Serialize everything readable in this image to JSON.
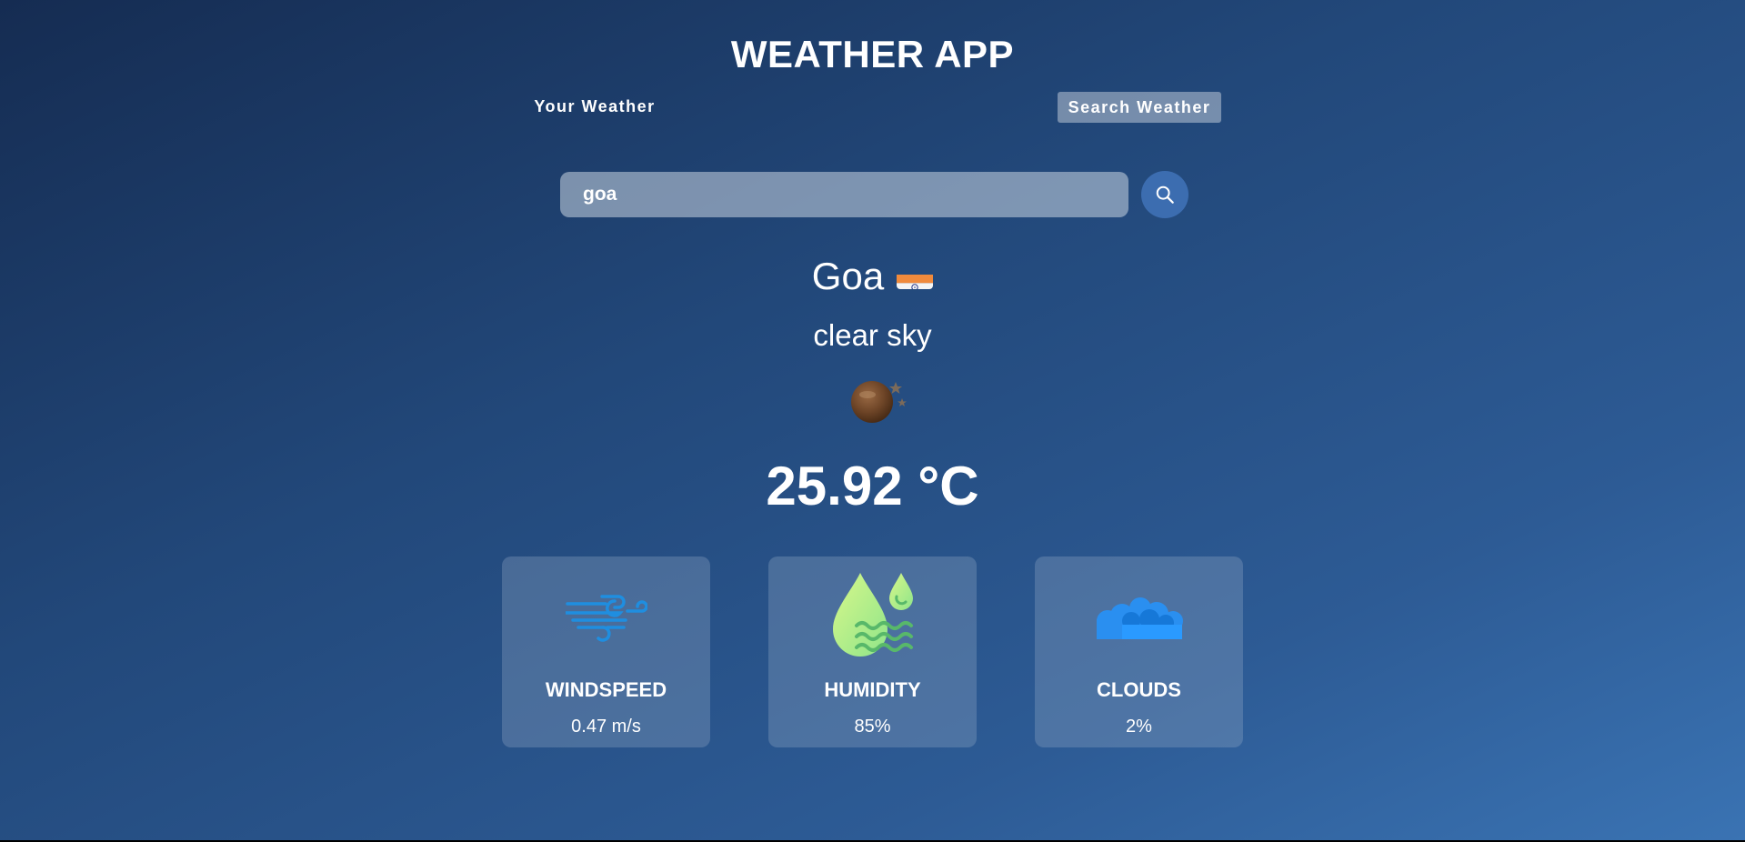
{
  "header": {
    "title": "WEATHER APP"
  },
  "tabs": [
    {
      "label": "Your Weather",
      "active": false
    },
    {
      "label": "Search Weather",
      "active": true
    }
  ],
  "search": {
    "value": "goa",
    "button_icon": "search-icon"
  },
  "weather": {
    "city": "Goa",
    "country_flag": "flag-india-icon",
    "description": "clear sky",
    "icon": "clear-sky-night-icon",
    "temperature": "25.92 °C"
  },
  "stats": [
    {
      "label": "WINDSPEED",
      "value": "0.47 m/s",
      "icon": "wind-icon"
    },
    {
      "label": "HUMIDITY",
      "value": "85%",
      "icon": "humidity-icon"
    },
    {
      "label": "CLOUDS",
      "value": "2%",
      "icon": "clouds-icon"
    }
  ],
  "colors": {
    "background_top": "#152c52",
    "background_bottom": "#3a73b3",
    "search_button": "#3c6db0",
    "wind_icon": "#1f8ee0",
    "humidity_icon": "#b8ee7c",
    "clouds_icon": "#2a8ff0"
  }
}
